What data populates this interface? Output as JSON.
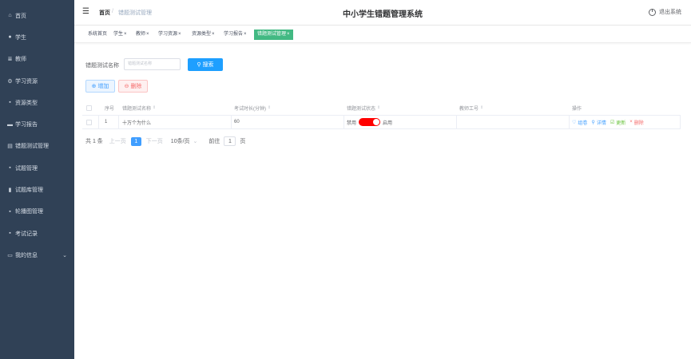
{
  "sidebar": {
    "items": [
      {
        "label": "首页",
        "icon": "home-icon",
        "glyph": "⌂"
      },
      {
        "label": "学生",
        "icon": "user-icon",
        "glyph": "●"
      },
      {
        "label": "教师",
        "icon": "list-icon",
        "glyph": "≣"
      },
      {
        "label": "学习资源",
        "icon": "network-icon",
        "glyph": "⚙"
      },
      {
        "label": "资源类型",
        "icon": "grid-icon",
        "glyph": "▪"
      },
      {
        "label": "学习报告",
        "icon": "monitor-icon",
        "glyph": "▬"
      },
      {
        "label": "错题测试管理",
        "icon": "database-icon",
        "glyph": "▤"
      },
      {
        "label": "试题管理",
        "icon": "grid-icon",
        "glyph": "▪"
      },
      {
        "label": "试题库管理",
        "icon": "bar-chart-icon",
        "glyph": "▮"
      },
      {
        "label": "轮播图管理",
        "icon": "grid-icon",
        "glyph": "▪"
      },
      {
        "label": "考试记录",
        "icon": "grid-icon",
        "glyph": "▪"
      },
      {
        "label": "我的信息",
        "icon": "id-card-icon",
        "glyph": "▭",
        "arrow": "⌄"
      }
    ]
  },
  "header": {
    "fold_glyph": "☰",
    "breadcrumb_home": "首页",
    "breadcrumb_sep": "/",
    "breadcrumb_current": "错题测试管理",
    "title": "中小学生错题管理系统",
    "logout_label": "退出系统"
  },
  "tags": [
    {
      "label": "系统首页",
      "closable": false
    },
    {
      "label": "学生",
      "closable": true
    },
    {
      "label": "教师",
      "closable": true
    },
    {
      "label": "学习资源",
      "closable": true
    },
    {
      "label": "资源类型",
      "closable": true
    },
    {
      "label": "学习报告",
      "closable": true
    },
    {
      "label": "错题测试管理",
      "closable": true,
      "active": true
    }
  ],
  "tag_close": "×",
  "search": {
    "label": "错题测试名称",
    "placeholder": "错题测试名称",
    "button_label": "搜索",
    "button_glyph": "⚲"
  },
  "actions": {
    "add_label": "增加",
    "add_glyph": "⊕",
    "delete_label": "删除",
    "delete_glyph": "⊖"
  },
  "table": {
    "columns": [
      "序号",
      "错题测试名称",
      "考试时长(分钟)",
      "错题测试状态",
      "教师工号",
      "操作"
    ],
    "sort_glyph": "⇕",
    "rows": [
      {
        "index": "1",
        "name": "十万个为什么",
        "duration": "60",
        "status_off": "禁用",
        "status_on": "启用",
        "status_enabled": true,
        "teacher_id": "",
        "ops": {
          "view": "组卷",
          "detail": "详情",
          "edit": "更新",
          "remove": "删除"
        }
      }
    ]
  },
  "op_glyphs": {
    "view": "♡",
    "detail": "⚲",
    "edit": "☑",
    "remove": "×"
  },
  "pager": {
    "total": "共 1 条",
    "prev": "上一页",
    "current": "1",
    "next": "下一页",
    "page_size": "10条/页",
    "page_size_arrow": "⌄",
    "goto_label": "前往",
    "goto_value": "1",
    "page_unit": "页"
  },
  "colors": {
    "sidebar_bg": "#304156",
    "tag_active": "#42b983",
    "primary": "#1e9fff",
    "switch_on": "#ff0000"
  }
}
